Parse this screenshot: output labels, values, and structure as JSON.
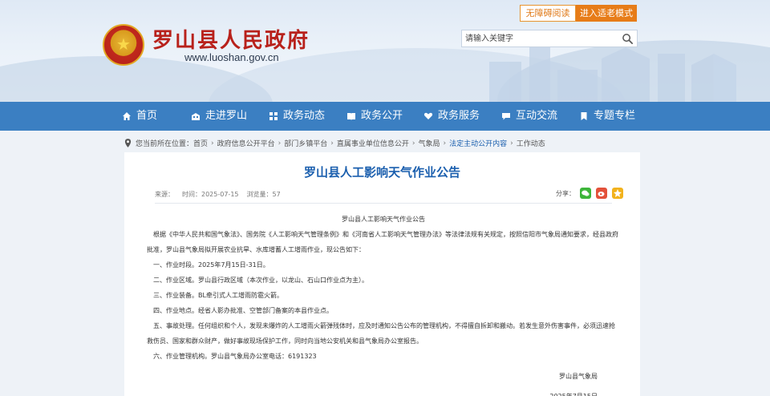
{
  "header": {
    "site_title": "罗山县人民政府",
    "site_url": "www.luoshan.gov.cn",
    "accessible_label": "无障碍阅读",
    "elder_mode_label": "进入适老模式",
    "search_placeholder": "请输入关键字"
  },
  "nav": {
    "items": [
      {
        "label": "首页",
        "icon": "home-icon"
      },
      {
        "label": "走进罗山",
        "icon": "building-icon"
      },
      {
        "label": "政务动态",
        "icon": "grid-icon"
      },
      {
        "label": "政务公开",
        "icon": "book-icon"
      },
      {
        "label": "政务服务",
        "icon": "heart-hand-icon"
      },
      {
        "label": "互动交流",
        "icon": "chat-icon"
      },
      {
        "label": "专题专栏",
        "icon": "bookmark-icon"
      }
    ]
  },
  "breadcrumb": {
    "prefix": "您当前所在位置：",
    "items": [
      "首页",
      "政府信息公开平台",
      "部门乡镇平台",
      "直属事业单位信息公开",
      "气象局",
      "法定主动公开内容",
      "工作动态"
    ]
  },
  "article": {
    "title": "罗山县人工影响天气作业公告",
    "source_label": "来源：",
    "time_label": "时间：",
    "time_value": "2025-07-15",
    "views_label": "浏览量：",
    "views_value": "57",
    "share_label": "分享：",
    "paragraphs": [
      "罗山县人工影响天气作业公告",
      "根据《中华人民共和国气象法》、国务院《人工影响天气管理条例》和《河南省人工影响天气管理办法》等法律法规有关规定，按照信阳市气象局通知要求，经县政府批准，罗山县气象局拟开展农业抗旱、水库增蓄人工增雨作业，现公告如下：",
      "一、作业时段。2025年7月15日-31日。",
      "二、作业区域。罗山县行政区域（本次作业，以龙山、石山口作业点为主）。",
      "三、作业装备。BL牵引式人工增雨防雹火箭。",
      "四、作业地点。经省人影办批准、空管部门备案的本县作业点。",
      "五、事故处理。任何组织和个人，发现未爆炸的人工增雨火箭弹残体时，应及时通知公告公布的管理机构，不得擅自拆卸和搬动。若发生意外伤害事件，必须迅速抢救伤员、国家和群众财产，做好事故现场保护工作，同时向当地公安机关和县气象局办公室报告。",
      "六、作业管理机构。罗山县气象局办公室电话：6191323",
      "罗山县气象局",
      "2025年7月15日"
    ]
  },
  "colors": {
    "brand_red": "#b8211b",
    "nav_blue": "#3b7fc2",
    "link_blue": "#1b5fae",
    "orange": "#e77c18",
    "wechat_green": "#3db53a",
    "weibo_red": "#e3513a",
    "qzone_yellow": "#f2b21c"
  }
}
